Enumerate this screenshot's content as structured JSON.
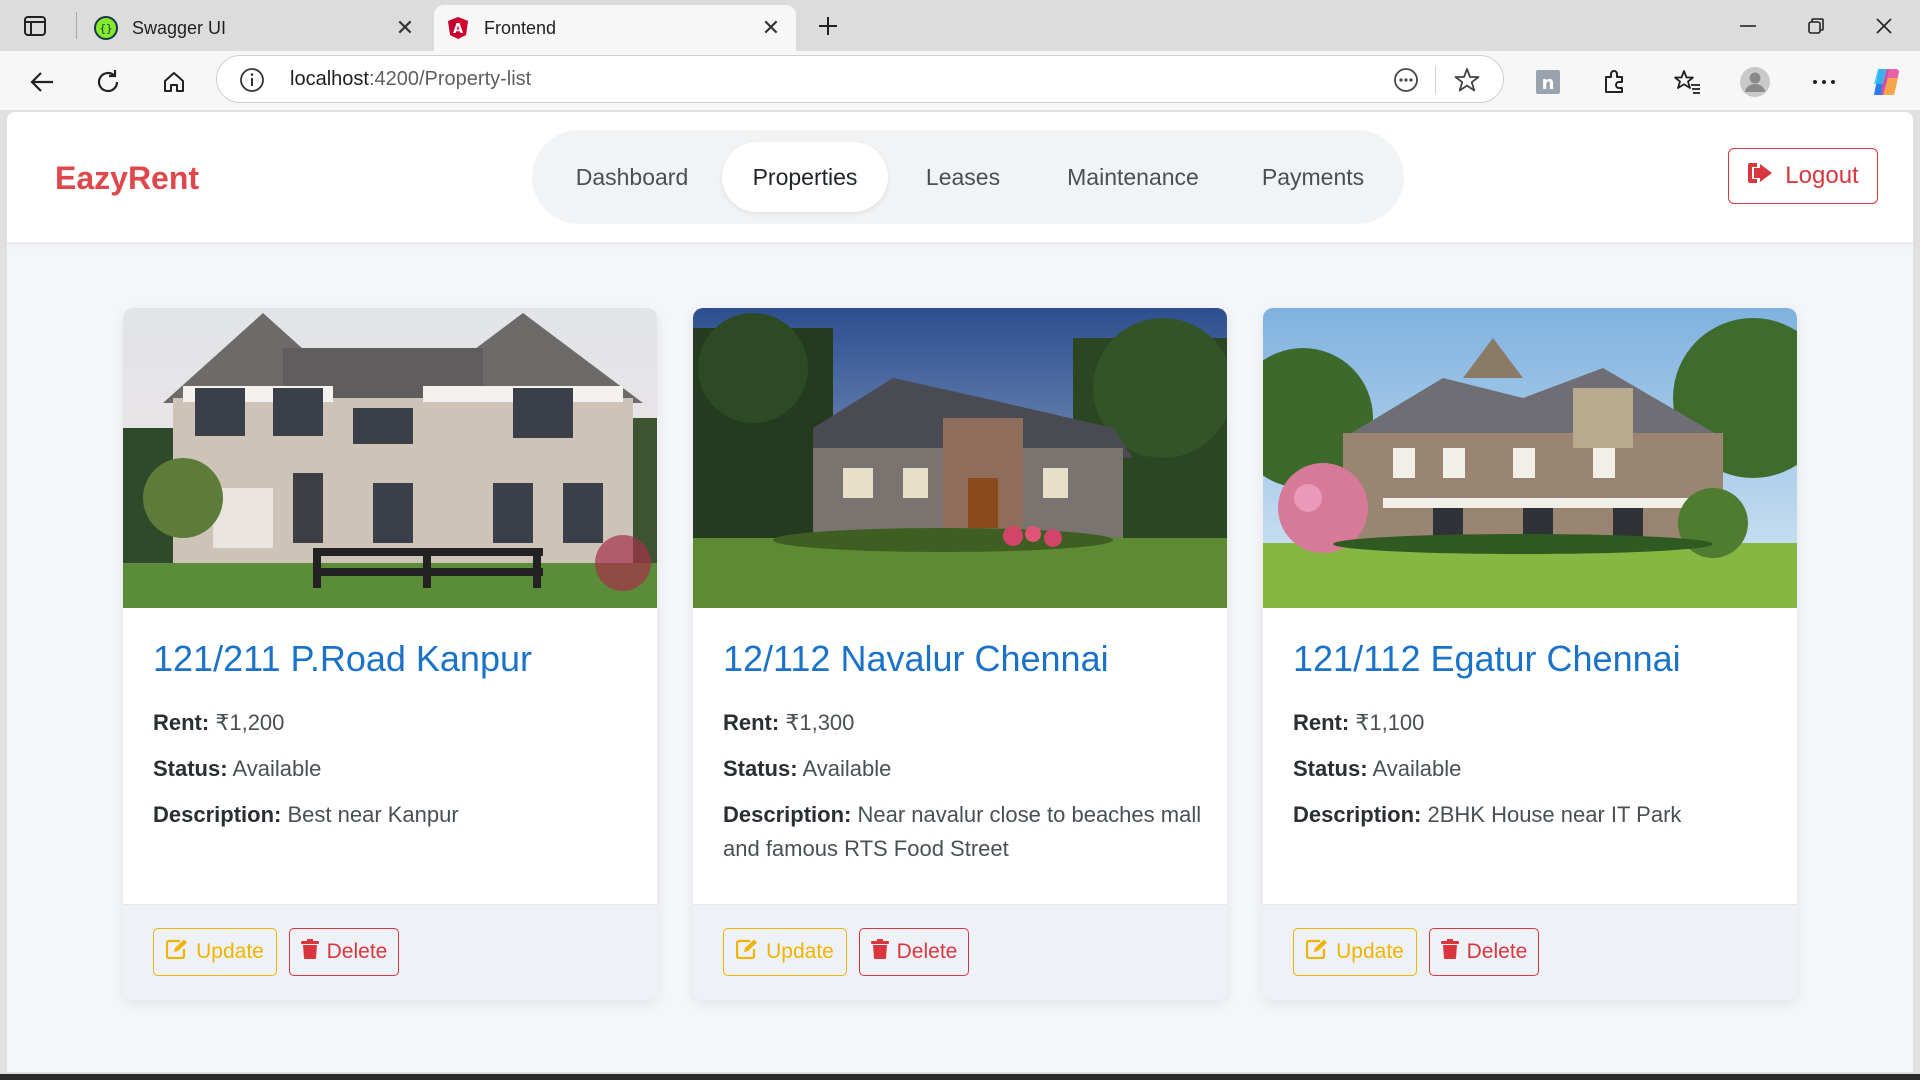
{
  "browser": {
    "tabs": [
      {
        "title": "Swagger UI",
        "icon": "swagger-icon"
      },
      {
        "title": "Frontend",
        "icon": "angular-icon"
      }
    ],
    "url_host": "localhost",
    "url_path": ":4200/Property-list"
  },
  "navbar": {
    "brand": "EazyRent",
    "items": [
      "Dashboard",
      "Properties",
      "Leases",
      "Maintenance",
      "Payments"
    ],
    "active_item": "Properties",
    "logout_label": "Logout"
  },
  "labels": {
    "rent": "Rent:",
    "status": "Status:",
    "description": "Description:",
    "update": "Update",
    "delete": "Delete"
  },
  "properties": [
    {
      "title": "121/211 P.Road Kanpur",
      "rent": "₹1,200",
      "status": "Available",
      "description": "Best near Kanpur"
    },
    {
      "title": "12/112 Navalur Chennai",
      "rent": "₹1,300",
      "status": "Available",
      "description": "Near navalur close to beaches mall and famous RTS Food Street"
    },
    {
      "title": "121/112 Egatur Chennai",
      "rent": "₹1,100",
      "status": "Available",
      "description": "2BHK House near IT Park"
    }
  ],
  "colors": {
    "brand": "#e0474c",
    "title_link": "#1a73c9",
    "update": "#f0b400",
    "delete": "#d9363e"
  }
}
